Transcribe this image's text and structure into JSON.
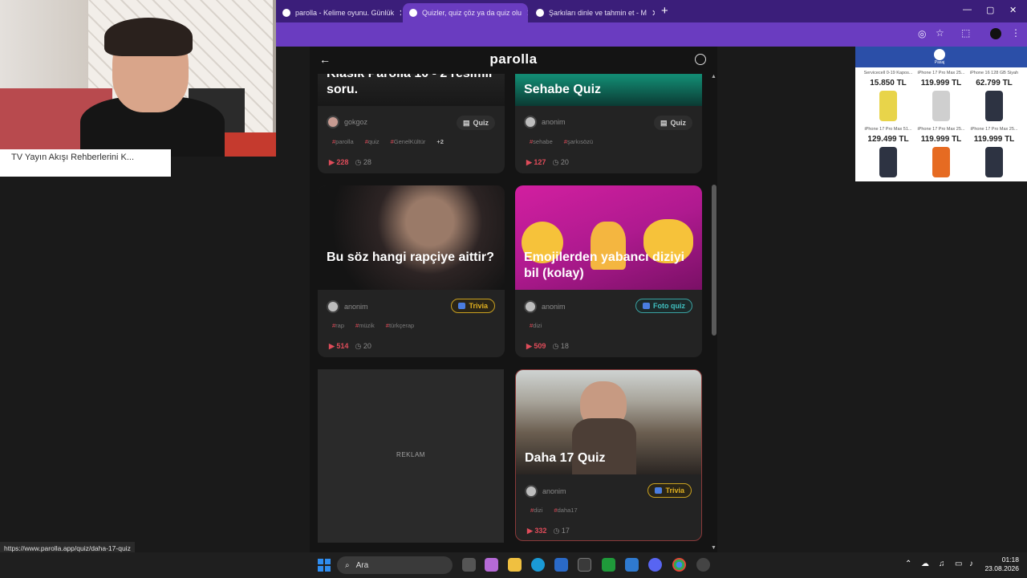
{
  "browser": {
    "tabs": [
      {
        "label": "parolla - Kelime oyunu. Günlük",
        "active": false
      },
      {
        "label": "Quizler, quiz çöz ya da quiz olu",
        "active": true
      },
      {
        "label": "Şarkıları dinle ve tahmin et - M",
        "active": false
      }
    ],
    "new_tab": "+",
    "close_glyph": "✕",
    "window_controls": [
      "—",
      "▢",
      "✕"
    ]
  },
  "webcam_caption": "TV Yayın Akışı Rehberlerini K...",
  "app": {
    "logo": "parolla",
    "back_icon": "arrow-left-icon",
    "user_icon": "user-circle-icon"
  },
  "cards": [
    {
      "title": "Klasik Parolla 10 - 2 resimli soru.",
      "author": "gokgoz",
      "badge": "Quiz",
      "badge_type": "quiz",
      "tags": [
        "parolla",
        "quiz",
        "GenelKültür"
      ],
      "more": "+2",
      "plays": "228",
      "questions": "28"
    },
    {
      "title": "Sehabe Quiz",
      "author": "anonim",
      "badge": "Quiz",
      "badge_type": "quiz",
      "tags": [
        "sehabe",
        "şarkısözü"
      ],
      "plays": "127",
      "questions": "20"
    },
    {
      "title": "Bu söz hangi rapçiye aittir?",
      "author": "anonim",
      "badge": "Trivia",
      "badge_type": "trivia",
      "tags": [
        "rap",
        "müzik",
        "türkçerap"
      ],
      "plays": "514",
      "questions": "20"
    },
    {
      "title": "Emojilerden yabancı diziyi bil (kolay)",
      "author": "anonim",
      "badge": "Foto quiz",
      "badge_type": "foto",
      "tags": [
        "dizi"
      ],
      "plays": "509",
      "questions": "18"
    },
    {
      "title": "Daha 17 Quiz",
      "author": "anonim",
      "badge": "Trivia",
      "badge_type": "trivia",
      "tags": [
        "dizi",
        "daha17"
      ],
      "plays": "332",
      "questions": "17"
    }
  ],
  "ad_label": "REKLAM",
  "right_ad": {
    "brand": "Pasaj",
    "items": [
      {
        "name": "Servicecell 0-19 Kapos...",
        "price": "15.850 TL"
      },
      {
        "name": "iPhone 17 Pro Max 25...",
        "price": "119.999 TL"
      },
      {
        "name": "iPhone 16 128 GB Siyah",
        "price": "62.799 TL"
      },
      {
        "name": "iPhone 17 Pro Max 51...",
        "price": "129.499 TL"
      },
      {
        "name": "iPhone 17 Pro Max 25...",
        "price": "119.999 TL"
      },
      {
        "name": "iPhone 17 Pro Max 25...",
        "price": "119.999 TL"
      }
    ]
  },
  "status_url": "https://www.parolla.app/quiz/daha-17-quiz",
  "taskbar": {
    "search_label": "Ara",
    "time": "01:18",
    "date": "23.08.2026"
  }
}
